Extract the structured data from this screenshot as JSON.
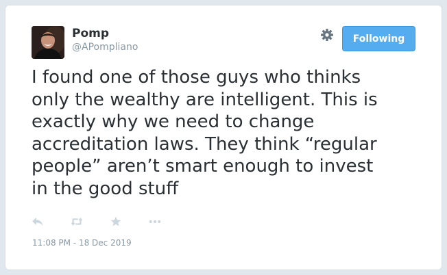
{
  "tweet": {
    "author": {
      "name": "Pomp",
      "handle": "@APompliano"
    },
    "follow_button_label": "Following",
    "text": "I found one of those guys who thinks\nonly the wealthy are intelligent. This is\nexactly why we need to change\naccreditation laws. They think “regular\npeople” aren’t smart enough to invest\nin the good stuff",
    "timestamp": "11:08 PM - 18 Dec 2019",
    "icons": {
      "settings": "gear-icon",
      "reply": "reply-icon",
      "retweet": "retweet-icon",
      "like": "star-icon",
      "more": "more-icon"
    },
    "colors": {
      "accent": "#55acee",
      "text": "#292f33",
      "muted": "#8899a6",
      "icon": "#ccd6dd"
    }
  }
}
